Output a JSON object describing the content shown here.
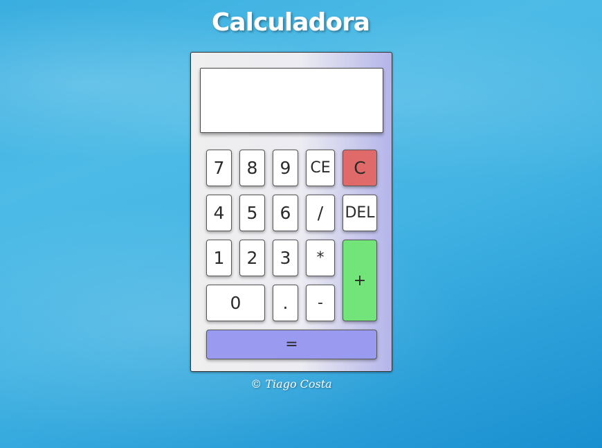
{
  "header": {
    "title": "Calculadora"
  },
  "display": {
    "value": ""
  },
  "keys": {
    "k7": "7",
    "k8": "8",
    "k9": "9",
    "ce": "CE",
    "c": "C",
    "k4": "4",
    "k5": "5",
    "k6": "6",
    "divide": "/",
    "del": "DEL",
    "k1": "1",
    "k2": "2",
    "k3": "3",
    "multiply": "*",
    "plus": "+",
    "k0": "0",
    "dot": ".",
    "minus": "-",
    "equals": "="
  },
  "footer": {
    "text": "© Tiago Costa"
  },
  "colors": {
    "clear_button": "#e06a6a",
    "plus_button": "#72e47a",
    "equals_button": "#9a9af0"
  }
}
